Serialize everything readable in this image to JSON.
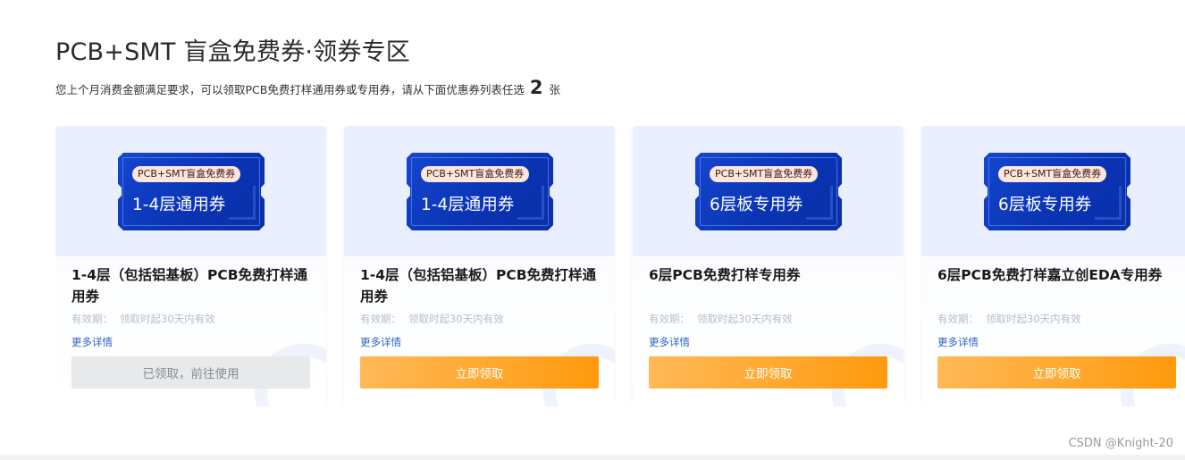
{
  "header": {
    "title": "PCB+SMT 盲盒免费券·领券专区",
    "subtitle_prefix": "您上个月消费金额满足要求，可以领取PCB免费打样通用券或专用券，请从下面优惠券列表任选",
    "subtitle_count": "2",
    "subtitle_suffix": "张"
  },
  "cards": [
    {
      "badge": "PCB+SMT盲盒免费券",
      "ticket_name": "1-4层通用券",
      "name": "1-4层（包括铝基板）PCB免费打样通用券",
      "validity_label": "有效期：",
      "validity_value": "领取时起30天内有效",
      "more_label": "更多详情",
      "button_label": "已领取，前往使用",
      "claimed": true
    },
    {
      "badge": "PCB+SMT盲盒免费券",
      "ticket_name": "1-4层通用券",
      "name": "1-4层（包括铝基板）PCB免费打样通用券",
      "validity_label": "有效期：",
      "validity_value": "领取时起30天内有效",
      "more_label": "更多详情",
      "button_label": "立即领取",
      "claimed": false
    },
    {
      "badge": "PCB+SMT盲盒免费券",
      "ticket_name": "6层板专用券",
      "name": "6层PCB免费打样专用券",
      "validity_label": "有效期：",
      "validity_value": "领取时起30天内有效",
      "more_label": "更多详情",
      "button_label": "立即领取",
      "claimed": false
    },
    {
      "badge": "PCB+SMT盲盒免费券",
      "ticket_name": "6层板专用券",
      "name": "6层PCB免费打样嘉立创EDA专用券",
      "validity_label": "有效期：",
      "validity_value": "领取时起30天内有效",
      "more_label": "更多详情",
      "button_label": "立即领取",
      "claimed": false
    }
  ],
  "watermark": "CSDN @Knight-20",
  "colors": {
    "ticket_blue": "#0a34b5",
    "claim_button": "#ff9a0e",
    "link_blue": "#2a62c9",
    "claimed_button_bg": "#e8e9eb"
  }
}
